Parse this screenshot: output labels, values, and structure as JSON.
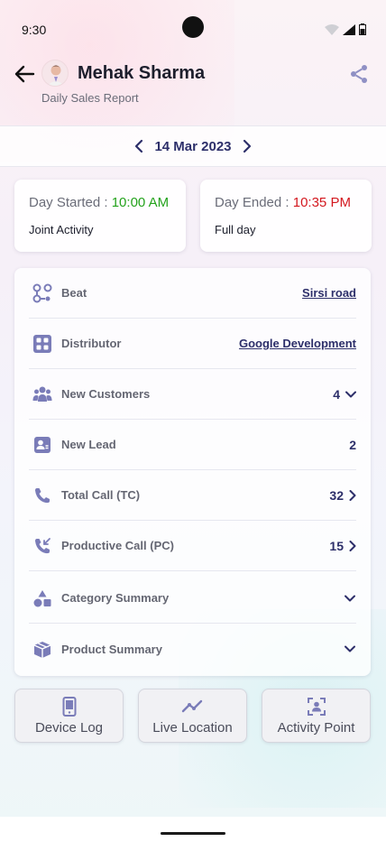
{
  "status_bar": {
    "time": "9:30"
  },
  "header": {
    "name": "Mehak Sharma",
    "subtitle": "Daily Sales Report"
  },
  "date_bar": {
    "date": "14 Mar 2023"
  },
  "day_started": {
    "label": "Day Started :",
    "time": "10:00 AM",
    "sub": "Joint Activity"
  },
  "day_ended": {
    "label": "Day Ended :",
    "time": "10:35 PM",
    "sub": "Full day"
  },
  "summary": {
    "beat": {
      "label": "Beat",
      "value": "Sirsi road"
    },
    "distributor": {
      "label": "Distributor",
      "value": "Google Development"
    },
    "new_customers": {
      "label": "New Customers",
      "value": "4"
    },
    "new_lead": {
      "label": "New Lead",
      "value": "2"
    },
    "total_call": {
      "label": "Total Call (TC)",
      "value": "32"
    },
    "productive_call": {
      "label": "Productive Call (PC)",
      "value": "15"
    },
    "category_summary": {
      "label": "Category Summary"
    },
    "product_summary": {
      "label": "Product Summary"
    }
  },
  "actions": {
    "device_log": "Device Log",
    "live_location": "Live Location",
    "activity_point": "Activity Point"
  },
  "colors": {
    "accent": "#2d2f6a",
    "icon": "#7a7cb8",
    "started": "#23a21b",
    "ended": "#d3171e"
  },
  "icons": [
    "back-arrow",
    "share",
    "chevron-left",
    "chevron-right",
    "chevron-down",
    "route",
    "distributor-grid",
    "users-group",
    "lead-card",
    "phone",
    "phone-incoming",
    "shapes",
    "box",
    "mobile-device",
    "trend-line",
    "scan-person"
  ]
}
